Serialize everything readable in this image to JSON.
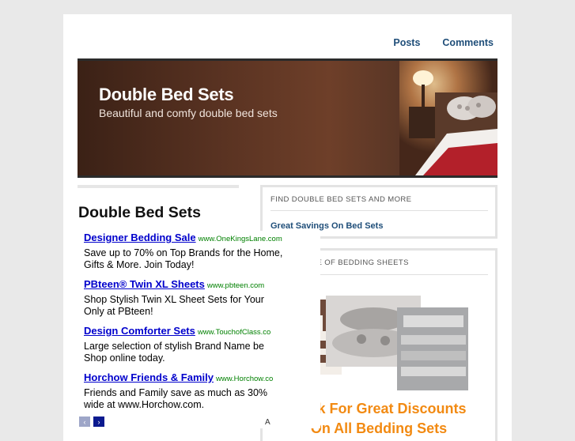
{
  "nav": {
    "posts": "Posts",
    "comments": "Comments"
  },
  "header": {
    "title": "Double Bed Sets",
    "subtitle": "Beautiful and comfy double bed sets"
  },
  "main": {
    "heading": "Double Bed Sets"
  },
  "ads": [
    {
      "title": "Designer Bedding Sale",
      "url": "www.OneKingsLane.com",
      "line1": "Save up to 70% on Top Brands for the Home,",
      "line2": "Gifts & More. Join Today!"
    },
    {
      "title": "PBteen® Twin XL Sheets",
      "url": "www.pbteen.com",
      "line1": "Shop Stylish Twin XL Sheet Sets for Your",
      "line2": "Only at PBteen!"
    },
    {
      "title": "Design Comforter Sets",
      "url": "www.TouchofClass.co",
      "line1": "Large selection of stylish Brand Name be",
      "line2": "Shop online today."
    },
    {
      "title": "Horchow Friends & Family",
      "url": "www.Horchow.co",
      "line1": "Friends and Family save as much as 30%",
      "line2": "wide at www.Horchow.com."
    }
  ],
  "ad_controls": {
    "prev": "‹",
    "next": "›",
    "adchoices": "A"
  },
  "sidebar": {
    "box1": {
      "heading": "FIND DOUBLE BED SETS AND MORE",
      "link": "Great Savings On Bed Sets"
    },
    "box2": {
      "heading": "WIDE RANGE OF BEDDING SHEETS",
      "cta_line1": "Click For Great Discounts",
      "cta_line2": "On All Bedding Sets"
    }
  },
  "colors": {
    "link": "#1f4e79",
    "ad_title": "#0000cc",
    "ad_url": "#008000",
    "cta": "#f28a12",
    "header_bg": "#5a3322"
  }
}
